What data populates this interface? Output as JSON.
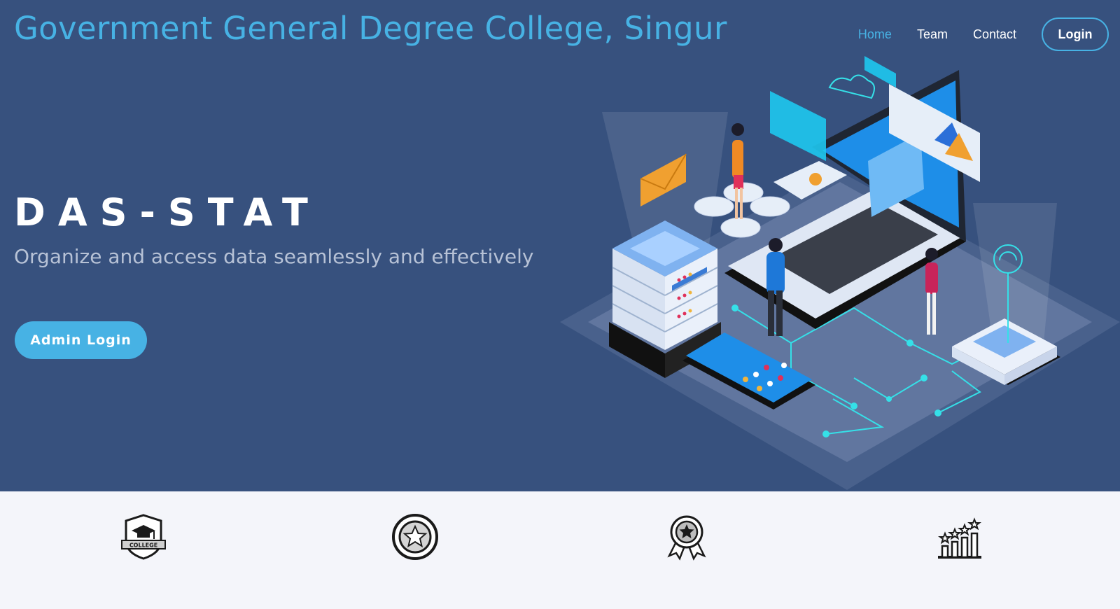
{
  "brand": {
    "title": "Government General Degree College, Singur"
  },
  "nav": {
    "items": [
      {
        "label": "Home",
        "active": true
      },
      {
        "label": "Team",
        "active": false
      },
      {
        "label": "Contact",
        "active": false
      }
    ],
    "login_label": "Login"
  },
  "hero": {
    "title": "DAS-STAT",
    "subtitle": "Organize and access data seamlessly and effectively",
    "button_label": "Admin Login",
    "illustration_icon": "data-center-laptop-illustration"
  },
  "features": {
    "icons": [
      "college-badge-icon",
      "star-coin-icon",
      "award-ribbon-icon",
      "growth-stars-chart-icon"
    ],
    "badge_text": "COLLEGE"
  },
  "colors": {
    "hero_bg": "#37517e",
    "accent": "#47b2e4",
    "subtitle": "#b7c2d6",
    "features_bg": "#f4f5fa"
  }
}
